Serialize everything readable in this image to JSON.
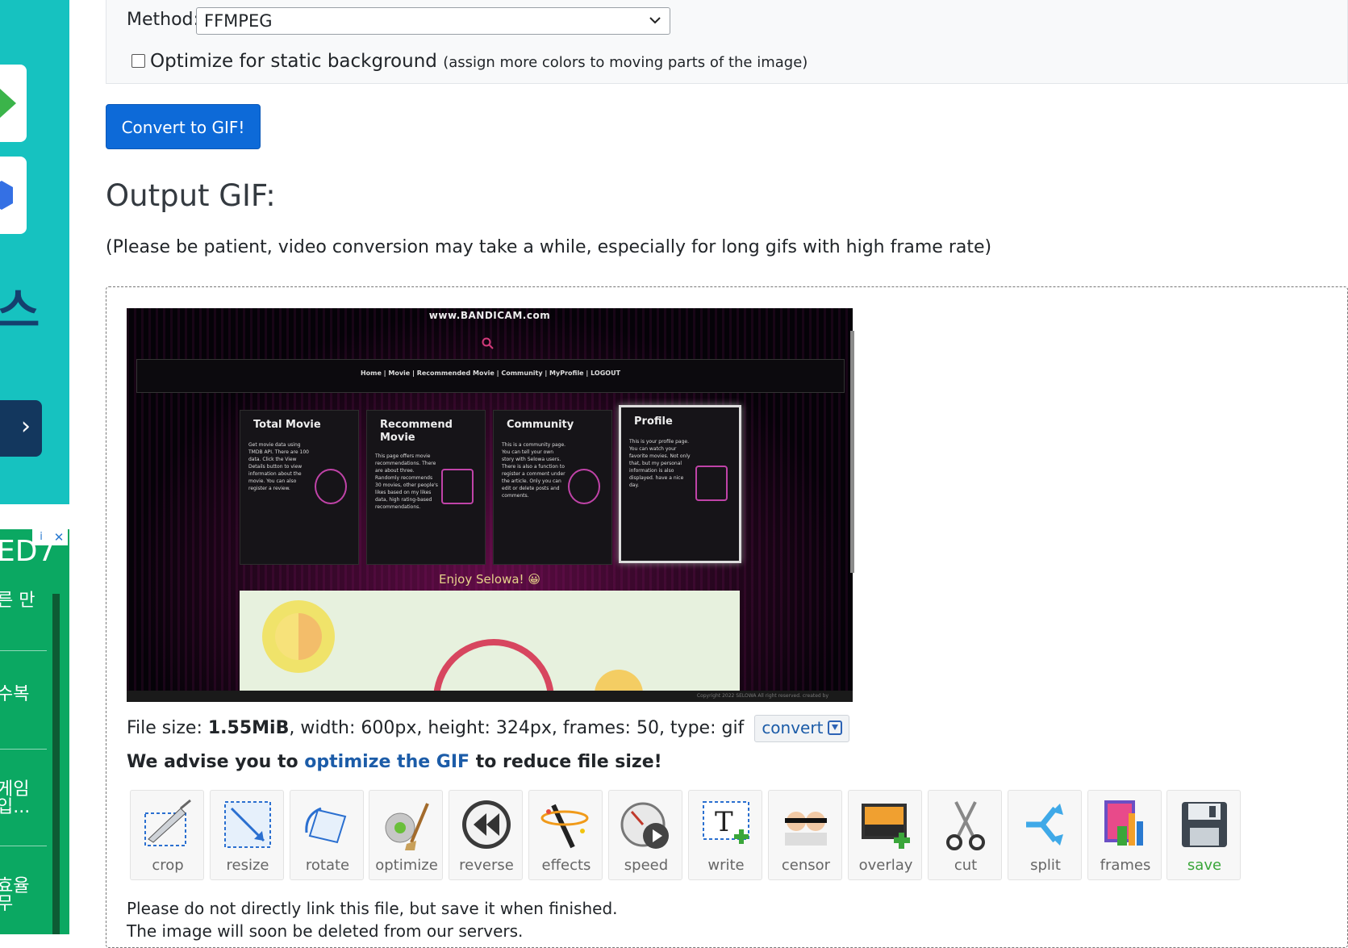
{
  "ad_top": {
    "glyph": "스",
    "arrow": "›"
  },
  "ad_bottom": {
    "title": "ED7",
    "info": "i",
    "close": "✕",
    "lines": [
      "른 만",
      "수복",
      "게임",
      "입...",
      "효율",
      "무"
    ]
  },
  "form": {
    "method_label": "Method:",
    "method_value": "FFMPEG",
    "optimize_label": "Optimize for static background",
    "optimize_hint": "(assign more colors to moving parts of the image)",
    "optimize_checked": false
  },
  "convert_button": "Convert to GIF!",
  "output": {
    "title": "Output GIF:",
    "patience": "(Please be patient, video conversion may take a while, especially for long gifs with high frame rate)"
  },
  "gif_preview": {
    "site": "www.BANDICAM.com",
    "nav": "Home | Movie | Recommended Movie | Community | MyProfile | LOGOUT",
    "cards": [
      {
        "title": "Total Movie",
        "desc": "Get movie data using TMDB API. There are 100 data. Click the View Details button to view information about the movie. You can also register a review."
      },
      {
        "title": "Recommend Movie",
        "desc": "This page offers movie recommendations. There are about three. Randomly recommends 30 movies, other people's likes based on my likes data, high rating-based recommendations."
      },
      {
        "title": "Community",
        "desc": "This is a community page. You can tell your own story with Selowa users. There is also a function to register a comment under the article. Only you can edit or delete posts and comments."
      },
      {
        "title": "Profile",
        "desc": "This is your profile page. You can watch your favorite movies. Not only that, but my personal information is also displayed. have a nice day."
      }
    ],
    "enjoy": "Enjoy Selowa! 😀",
    "footer": "Copyright 2022 SELOWA All right reserved. created by"
  },
  "file_info": {
    "prefix": "File size: ",
    "size": "1.55MiB",
    "rest": ", width: 600px, height: 324px, frames: 50, type: gif",
    "convert": "convert"
  },
  "advise": {
    "before": "We advise you to ",
    "link": "optimize the GIF",
    "after": " to reduce file size!"
  },
  "tools": [
    {
      "label": "crop",
      "icon": "crop-icon"
    },
    {
      "label": "resize",
      "icon": "resize-icon"
    },
    {
      "label": "rotate",
      "icon": "rotate-icon"
    },
    {
      "label": "optimize",
      "icon": "optimize-icon"
    },
    {
      "label": "reverse",
      "icon": "reverse-icon"
    },
    {
      "label": "effects",
      "icon": "effects-icon"
    },
    {
      "label": "speed",
      "icon": "speed-icon"
    },
    {
      "label": "write",
      "icon": "write-icon"
    },
    {
      "label": "censor",
      "icon": "censor-icon"
    },
    {
      "label": "overlay",
      "icon": "overlay-icon"
    },
    {
      "label": "cut",
      "icon": "scissors-icon"
    },
    {
      "label": "split",
      "icon": "split-icon"
    },
    {
      "label": "frames",
      "icon": "frames-icon"
    },
    {
      "label": "save",
      "icon": "save-icon"
    }
  ],
  "notes": {
    "line1": "Please do not directly link this file, but save it when finished.",
    "line2": "The image will soon be deleted from our servers."
  },
  "colors": {
    "primary": "#0d6ad8",
    "link": "#1c5ca8",
    "ad_teal": "#16c2c0",
    "ad_green": "#0ba862"
  }
}
